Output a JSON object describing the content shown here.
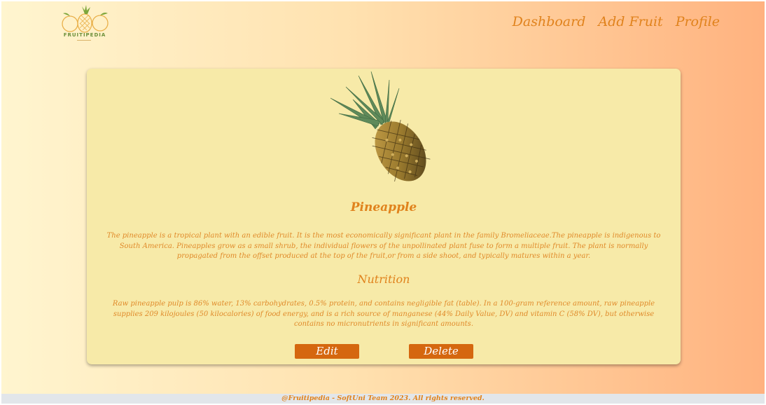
{
  "brand": {
    "logo_text": "FRUITIPEDIA"
  },
  "nav": {
    "items": [
      {
        "label": "Dashboard"
      },
      {
        "label": "Add Fruit"
      },
      {
        "label": "Profile"
      }
    ]
  },
  "fruit": {
    "name": "Pineapple",
    "image_icon": "pineapple-image",
    "description": "The pineapple is a tropical plant with an edible fruit. It is the most economically significant plant in the family Bromeliaceae.The pineapple is indigenous to South America. Pineapples grow as a small shrub, the individual flowers of the unpollinated plant fuse to form a multiple fruit. The plant is normally propagated from the offset produced at the top of the fruit,or from a side shoot, and typically matures within a year.",
    "nutrition_heading": "Nutrition",
    "nutrition_text": "Raw pineapple pulp is 86% water, 13% carbohydrates, 0.5% protein, and contains negligible fat (table). In a 100-gram reference amount, raw pineapple supplies 209 kilojoules (50 kilocalories) of food energy, and is a rich source of manganese (44% Daily Value, DV) and vitamin C (58% DV), but otherwise contains no micronutrients in significant amounts."
  },
  "actions": {
    "edit_label": "Edit",
    "delete_label": "Delete"
  },
  "footer": {
    "text": "@Fruitipedia - SoftUni Team 2023. All rights reserved."
  },
  "colors": {
    "accent": "#e0821c",
    "button": "#d5670f",
    "card": "#f7eaa8",
    "gradient_start": "#fff5cf",
    "gradient_end": "#ffb27f"
  }
}
